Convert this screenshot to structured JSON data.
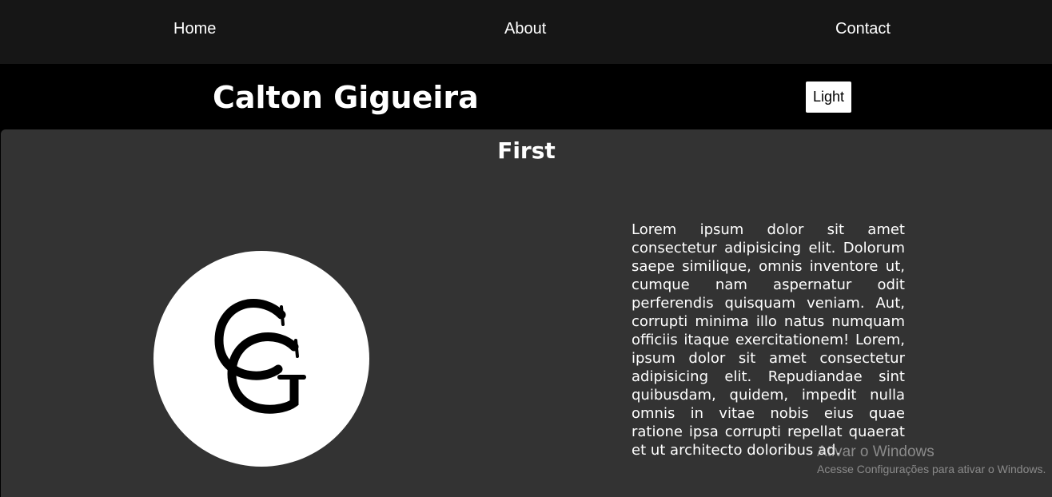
{
  "nav": {
    "links": [
      {
        "label": "Home"
      },
      {
        "label": "About"
      },
      {
        "label": "Contact"
      }
    ]
  },
  "header": {
    "title": "Calton Gigueira",
    "theme_button_label": "Light"
  },
  "section": {
    "title": "First",
    "logo_icon": "cg-monogram-logo",
    "logo_monogram": "CG",
    "body_text": "Lorem ipsum dolor sit amet consectetur adipisicing elit. Dolorum saepe similique, omnis inventore ut, cumque nam aspernatur odit perferendis quisquam veniam. Aut, corrupti minima illo natus numquam officiis itaque exercitationem! Lorem, ipsum dolor sit amet consectetur adipisicing elit. Repudiandae sint quibusdam, quidem, impedit nulla omnis in vitae nobis eius quae ratione ipsa corrupti repellat quaerat et ut architecto doloribus ad."
  },
  "watermark": {
    "title": "Ativar o Windows",
    "subtitle": "Acesse Configurações para ativar o Windows."
  },
  "colors": {
    "nav_bg": "#161616",
    "header_bg": "#000000",
    "section_bg": "#333333",
    "text": "#ffffff"
  }
}
